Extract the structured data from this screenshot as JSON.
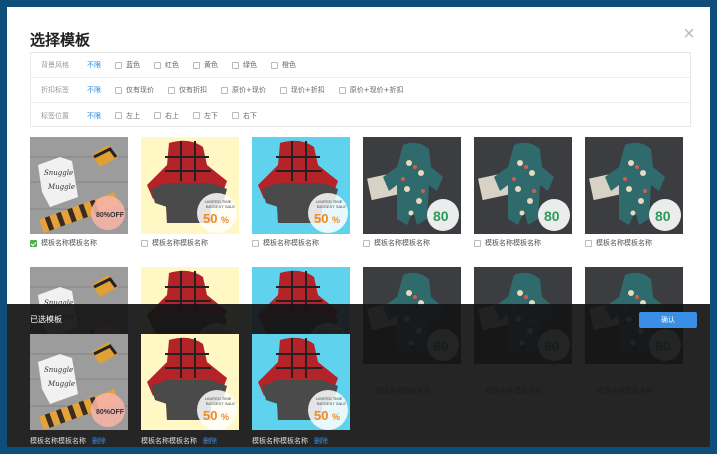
{
  "dialog": {
    "title": "选择模板",
    "close_glyph": "×"
  },
  "filters": [
    {
      "label": "背景风格",
      "nolimit": "不限",
      "options": [
        "蓝色",
        "红色",
        "黄色",
        "绿色",
        "橙色"
      ]
    },
    {
      "label": "折扣标签",
      "nolimit": "不限",
      "options": [
        "仅有现价",
        "仅有折扣",
        "原价+现价",
        "现价+折扣",
        "原价+现价+折扣"
      ]
    },
    {
      "label": "标签位置",
      "nolimit": "不限",
      "options": [
        "左上",
        "右上",
        "左下",
        "右下"
      ]
    }
  ],
  "templates_row1": [
    {
      "label": "模板名称模板名称",
      "checked": true,
      "style": "wood"
    },
    {
      "label": "模板名称模板名称",
      "checked": false,
      "style": "yellow"
    },
    {
      "label": "模板名称模板名称",
      "checked": false,
      "style": "cyan"
    },
    {
      "label": "模板名称模板名称",
      "checked": false,
      "style": "dark"
    },
    {
      "label": "模板名称模板名称",
      "checked": false,
      "style": "dark"
    },
    {
      "label": "模板名称模板名称",
      "checked": false,
      "style": "dark"
    }
  ],
  "templates_row2_labels": [
    "模板名称模板名称",
    "模板名称模板名称",
    "模板名称模板名称"
  ],
  "product_text": {
    "word1": "Snuggle",
    "word2": "Muggle",
    "off": "80%OFF",
    "limited": "LIMITED TIME",
    "biggest": "BIGGEST SALE",
    "pct50": "50",
    "pct80": "80",
    "pct_sign": "%"
  },
  "selected_panel": {
    "title": "已选模板",
    "confirm_label": "确认",
    "delete_label": "删除",
    "items": [
      {
        "label": "模板名称模板名称",
        "style": "wood"
      },
      {
        "label": "模板名称模板名称",
        "style": "yellow"
      },
      {
        "label": "模板名称模板名称",
        "style": "cyan"
      }
    ]
  }
}
